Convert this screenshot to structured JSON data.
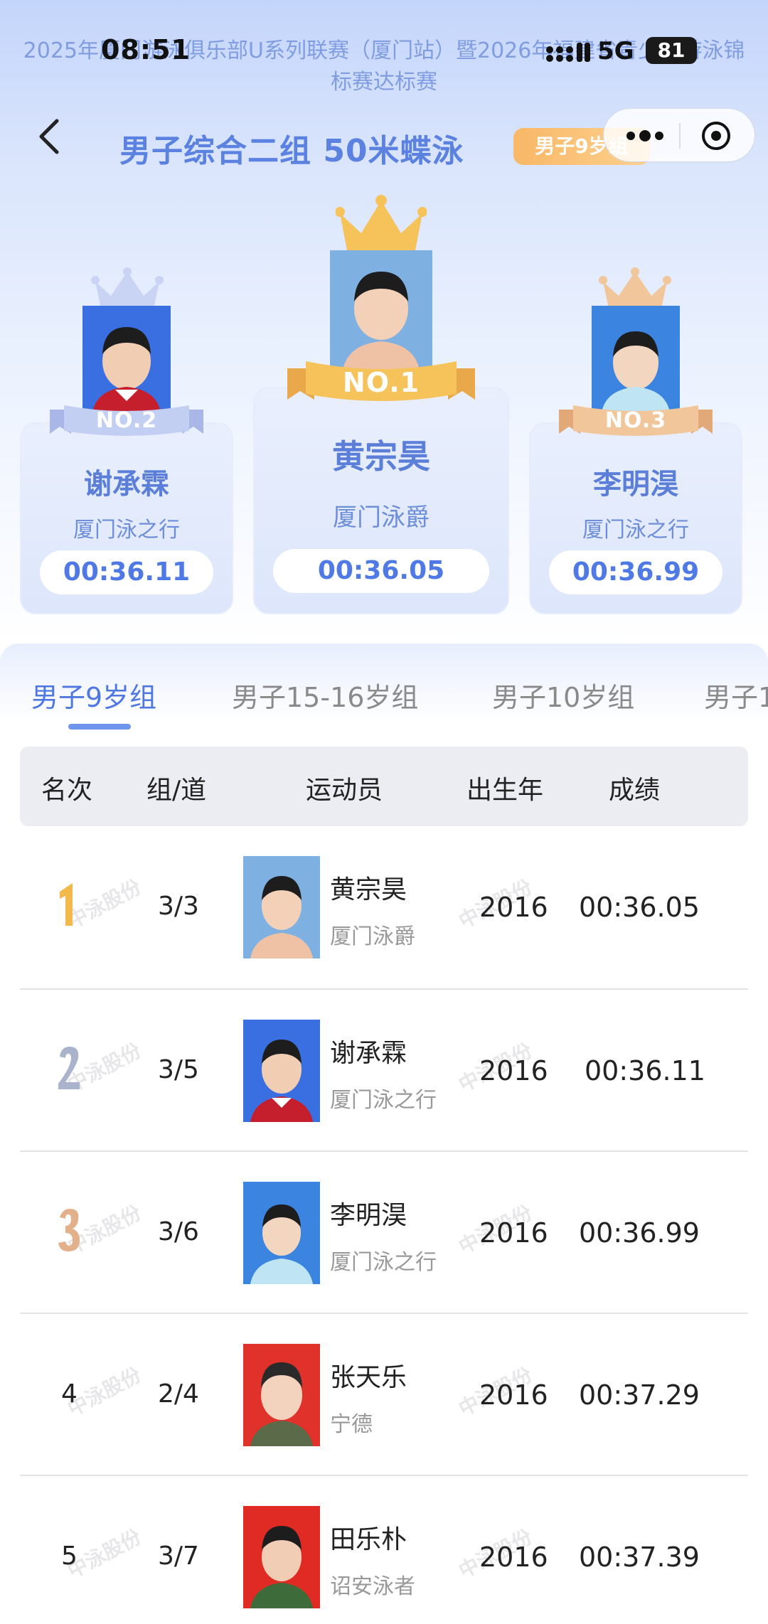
{
  "status": {
    "time": "08:51",
    "network": "5G",
    "battery": "81"
  },
  "event_title": "2025年厦门游泳俱乐部U系列联赛（厦门站）暨2026年福建省青少年游泳锦标赛达标赛",
  "header": {
    "title": "男子综合二组 50米蝶泳",
    "badge": "男子9岁组"
  },
  "podium": [
    {
      "rank_label": "NO.2",
      "name": "谢承霖",
      "club": "厦门泳之行",
      "time": "00:36.11",
      "crown_color": "#c9d4f4",
      "photo_bg": "#3a6fe2"
    },
    {
      "rank_label": "NO.1",
      "name": "黄宗昊",
      "club": "厦门泳爵",
      "time": "00:36.05",
      "crown_color": "#f6c25a",
      "photo_bg": "#7eb1e2"
    },
    {
      "rank_label": "NO.3",
      "name": "李明淏",
      "club": "厦门泳之行",
      "time": "00:36.99",
      "crown_color": "#f1c69b",
      "photo_bg": "#3b84e0"
    }
  ],
  "tabs": [
    "男子9岁组",
    "男子15-16岁组",
    "男子10岁组",
    "男子1"
  ],
  "table": {
    "headers": [
      "名次",
      "组/道",
      "运动员",
      "出生年",
      "成绩"
    ],
    "watermark": "中泳股份",
    "rows": [
      {
        "rank": "1",
        "lane": "3/3",
        "name": "黄宗昊",
        "club": "厦门泳爵",
        "year": "2016",
        "time": "00:36.05",
        "photo_bg": "#7eb1e2"
      },
      {
        "rank": "2",
        "lane": "3/5",
        "name": "谢承霖",
        "club": "厦门泳之行",
        "year": "2016",
        "time": "00:36.11",
        "photo_bg": "#3a6fe2"
      },
      {
        "rank": "3",
        "lane": "3/6",
        "name": "李明淏",
        "club": "厦门泳之行",
        "year": "2016",
        "time": "00:36.99",
        "photo_bg": "#3b84e0"
      },
      {
        "rank": "4",
        "lane": "2/4",
        "name": "张天乐",
        "club": "宁德",
        "year": "2016",
        "time": "00:37.29",
        "photo_bg": "#e0322a"
      },
      {
        "rank": "5",
        "lane": "3/7",
        "name": "田乐朴",
        "club": "诏安泳者",
        "year": "2016",
        "time": "00:37.39",
        "photo_bg": "#df2b24"
      }
    ]
  },
  "colors": {
    "accent": "#4e77e2",
    "gold": "#f6c25a",
    "silver": "#c9d4f4",
    "bronze": "#f1c69b"
  }
}
